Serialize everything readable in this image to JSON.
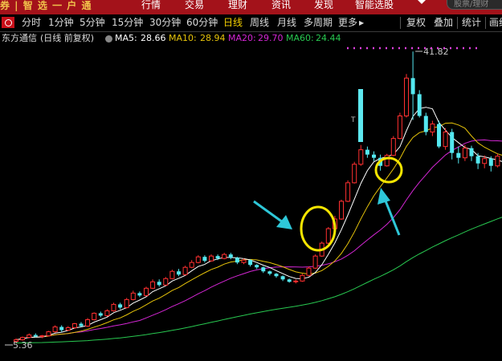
{
  "header": {
    "brand": "券 | 智 选 一 户 通",
    "menu": [
      "行情",
      "交易",
      "理财",
      "资讯",
      "发现",
      "智能选股"
    ],
    "search_placeholder": "股票/理财"
  },
  "tabs": {
    "periods": [
      "分时",
      "1分钟",
      "5分钟",
      "15分钟",
      "30分钟",
      "60分钟",
      "日线",
      "周线",
      "月线",
      "多周期",
      "更多"
    ],
    "active_period": "日线",
    "more_arrow": "▶",
    "actions": [
      "复权",
      "叠加",
      "统计",
      "画线"
    ]
  },
  "stock": {
    "name": "东方通信",
    "mode": "(日线 前复权)",
    "ma": [
      {
        "label": "MA5:",
        "value": "28.66",
        "color": "#ffffff"
      },
      {
        "label": "MA10:",
        "value": "28.94",
        "color": "#e6c30a"
      },
      {
        "label": "MA20:",
        "value": "29.70",
        "color": "#d426d4"
      },
      {
        "label": "MA60:",
        "value": "24.44",
        "color": "#28c850"
      }
    ]
  },
  "chart_data": {
    "type": "candlestick",
    "high_label": "41.82",
    "low_label": "5.36",
    "colors": {
      "up": "#ff3030",
      "down": "#54e8f0",
      "ma5": "#ffffff",
      "ma10": "#e6c30a",
      "ma20": "#d426d4",
      "ma60": "#28c850",
      "highlight": "#f5e500",
      "dotted": "#e040e0"
    },
    "candles": [
      [
        5.8,
        6.0,
        5.6,
        6.2
      ],
      [
        6.0,
        6.3,
        5.9,
        6.4
      ],
      [
        6.3,
        6.6,
        6.2,
        6.8
      ],
      [
        6.6,
        6.4,
        6.3,
        6.8
      ],
      [
        6.4,
        6.5,
        6.2,
        6.6
      ],
      [
        6.5,
        7.0,
        6.4,
        7.1
      ],
      [
        7.0,
        7.6,
        6.9,
        7.8
      ],
      [
        7.6,
        7.2,
        7.0,
        7.8
      ],
      [
        7.2,
        7.5,
        7.1,
        7.7
      ],
      [
        7.5,
        8.0,
        7.4,
        8.1
      ],
      [
        8.0,
        7.7,
        7.6,
        8.2
      ],
      [
        7.7,
        8.5,
        7.6,
        8.7
      ],
      [
        8.5,
        9.3,
        8.4,
        9.4
      ],
      [
        9.3,
        9.0,
        8.8,
        9.5
      ],
      [
        9.0,
        9.6,
        8.9,
        9.8
      ],
      [
        9.6,
        10.4,
        9.5,
        10.6
      ],
      [
        10.4,
        10.0,
        9.8,
        10.6
      ],
      [
        10.0,
        11.0,
        9.9,
        11.2
      ],
      [
        11.0,
        11.8,
        10.9,
        12.1
      ],
      [
        11.8,
        11.5,
        11.3,
        12.0
      ],
      [
        11.5,
        12.4,
        11.4,
        12.6
      ],
      [
        12.4,
        13.2,
        12.3,
        13.5
      ],
      [
        13.2,
        12.8,
        12.6,
        13.5
      ],
      [
        12.8,
        13.6,
        12.7,
        13.8
      ],
      [
        13.6,
        14.5,
        13.5,
        14.7
      ],
      [
        14.5,
        14.1,
        13.9,
        14.8
      ],
      [
        14.1,
        15.0,
        14.0,
        15.2
      ],
      [
        15.0,
        15.6,
        14.9,
        15.9
      ],
      [
        15.6,
        16.3,
        15.5,
        16.5
      ],
      [
        16.3,
        15.8,
        15.6,
        16.5
      ],
      [
        15.8,
        16.4,
        15.7,
        16.6
      ],
      [
        16.4,
        16.1,
        15.9,
        16.6
      ],
      [
        16.1,
        16.6,
        16.0,
        16.8
      ],
      [
        16.6,
        16.2,
        16.0,
        16.8
      ],
      [
        16.2,
        15.6,
        15.4,
        16.3
      ],
      [
        15.6,
        15.9,
        15.4,
        16.1
      ],
      [
        15.9,
        15.3,
        15.1,
        16.0
      ],
      [
        15.3,
        15.0,
        14.8,
        15.4
      ],
      [
        15.0,
        14.5,
        14.3,
        15.1
      ],
      [
        14.5,
        14.2,
        14.0,
        14.6
      ],
      [
        14.2,
        13.9,
        13.7,
        14.3
      ],
      [
        13.9,
        13.5,
        13.3,
        14.0
      ],
      [
        13.5,
        13.2,
        13.1,
        13.6
      ],
      [
        13.2,
        13.3,
        13.0,
        13.5
      ],
      [
        13.3,
        14.0,
        13.2,
        14.2
      ],
      [
        14.0,
        14.9,
        13.9,
        15.1
      ],
      [
        14.9,
        16.4,
        14.8,
        16.6
      ],
      [
        16.4,
        18.0,
        16.3,
        18.2
      ],
      [
        18.0,
        19.8,
        17.9,
        20.0
      ],
      [
        19.8,
        21.0,
        19.6,
        21.4
      ],
      [
        21.0,
        23.2,
        20.9,
        23.4
      ],
      [
        23.2,
        25.5,
        23.1,
        25.8
      ],
      [
        25.5,
        27.8,
        25.4,
        28.1
      ],
      [
        27.8,
        29.6,
        27.6,
        30.2
      ],
      [
        29.6,
        29.0,
        28.6,
        30.0
      ],
      [
        29.0,
        28.6,
        28.2,
        29.4
      ],
      [
        28.6,
        27.6,
        27.0,
        29.0
      ],
      [
        27.6,
        28.9,
        27.5,
        29.1
      ],
      [
        28.9,
        31.0,
        28.8,
        31.3
      ],
      [
        31.0,
        33.8,
        30.9,
        34.2
      ],
      [
        33.8,
        38.5,
        33.6,
        39.0
      ],
      [
        38.5,
        36.5,
        33.3,
        41.8
      ],
      [
        36.5,
        33.8,
        33.6,
        37.0
      ],
      [
        33.8,
        31.8,
        31.4,
        34.2
      ],
      [
        31.8,
        32.8,
        31.3,
        33.2
      ],
      [
        32.8,
        30.0,
        29.8,
        33.2
      ],
      [
        30.0,
        31.8,
        29.6,
        32.3
      ],
      [
        31.8,
        29.2,
        28.4,
        32.2
      ],
      [
        29.2,
        28.6,
        27.9,
        30.0
      ],
      [
        28.6,
        29.8,
        28.2,
        30.2
      ],
      [
        29.8,
        28.8,
        28.2,
        30.1
      ],
      [
        28.8,
        27.9,
        27.2,
        29.2
      ],
      [
        27.9,
        28.5,
        27.3,
        28.9
      ],
      [
        28.5,
        27.6,
        26.9,
        28.8
      ],
      [
        27.6,
        28.8,
        27.4,
        29.1
      ],
      [
        28.8,
        27.5,
        26.8,
        29.0
      ]
    ]
  }
}
